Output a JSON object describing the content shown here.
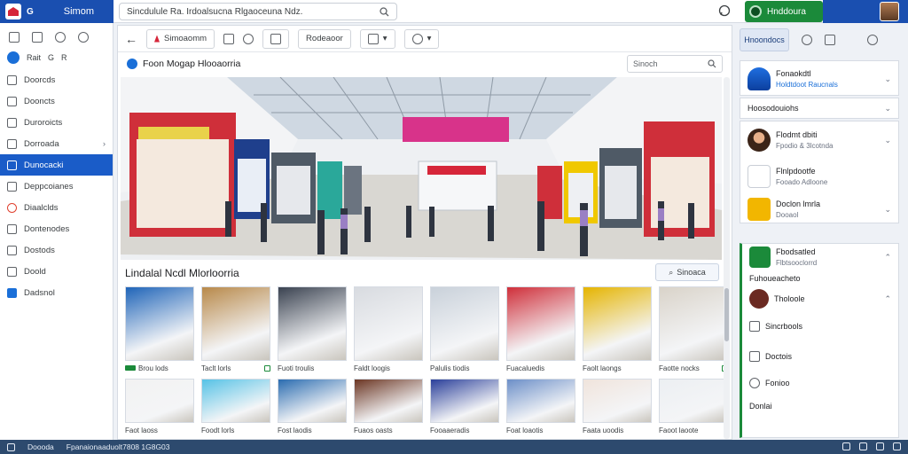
{
  "brand": {
    "logo": "store-logo",
    "short": "G",
    "name": "Simom"
  },
  "address_bar": {
    "value": "Sincdulule Ra. Irdoalsucna Rlgaoceuna Ndz."
  },
  "profile": {
    "label": "Hnddoura"
  },
  "sidebar": {
    "row2": [
      "Rait",
      "G",
      "R"
    ],
    "items": [
      {
        "label": "Doorcds",
        "icon": "doors-icon"
      },
      {
        "label": "Dooncts",
        "icon": "document-icon"
      },
      {
        "label": "Duroroicts",
        "icon": "list-icon"
      },
      {
        "label": "Dorroada",
        "icon": "folder-icon",
        "has_chevron": true
      },
      {
        "label": "Dunocacki",
        "icon": "store-icon",
        "active": true
      },
      {
        "label": "Deppcoianes",
        "icon": "device-icon"
      },
      {
        "label": "Diaalclds",
        "icon": "record-icon"
      },
      {
        "label": "Dontenodes",
        "icon": "file-icon"
      },
      {
        "label": "Dostods",
        "icon": "bag-icon"
      },
      {
        "label": "Doold",
        "icon": "note-icon"
      },
      {
        "label": "Dadsnol",
        "icon": "grid-icon"
      }
    ]
  },
  "toolbar": {
    "tab1": "Simoaomm",
    "tab2": "Rodeaoor"
  },
  "page": {
    "title": "Foon Mogap Hlooaorria",
    "search_placeholder": "Sinoch"
  },
  "gallery": {
    "title": "Lindalal Ncdl Mlorloorria",
    "search_label": "Sinoaca",
    "row1": [
      {
        "caption": "Brou lods",
        "badge": true
      },
      {
        "caption": "Taclt lorls",
        "check": true
      },
      {
        "caption": "Fuoti troulis"
      },
      {
        "caption": "Faldt loogis"
      },
      {
        "caption": "Palulis tiodis"
      },
      {
        "caption": "Fuacaluedis"
      },
      {
        "caption": "Faolt laongs"
      },
      {
        "caption": "Faotte nocks",
        "check": true
      }
    ],
    "row2": [
      {
        "caption": "Faot laoss"
      },
      {
        "caption": "Foodt lorls"
      },
      {
        "caption": "Fost laodis"
      },
      {
        "caption": "Fuaos oasts"
      },
      {
        "caption": "Fooaaeradis"
      },
      {
        "caption": "Foat loaotis"
      },
      {
        "caption": "Faata uoodis"
      },
      {
        "caption": "Faoot laoote"
      }
    ]
  },
  "right_panel": {
    "tab_active": "Hnoondocs",
    "items": [
      {
        "title": "Fonaokdtl",
        "sub": "Holdtdoot Raucnals"
      },
      {
        "title": "Hoosodouiohs"
      },
      {
        "title": "Flodmt dbiti",
        "sub": "Fpodio & 3lcotnda"
      },
      {
        "title": "Flnlpdootfe",
        "sub": "Fooado Adloone"
      },
      {
        "title": "Doclon lmrla",
        "sub": "Dooaol"
      },
      {
        "title": "Fbodsatled",
        "sub": "Flbtsooclorrd"
      },
      {
        "title": "Fuhoueacheto"
      },
      {
        "title": "Tholoole"
      },
      {
        "title": "Sincrbools"
      },
      {
        "title": "Doctois"
      },
      {
        "title": "Fonioo"
      },
      {
        "title": "Donlai"
      }
    ]
  },
  "status": {
    "left": "Doooda",
    "text": "Fpanaionaaduolt7808 1G8G03"
  },
  "colors": {
    "brand_blue": "#1a4fb0",
    "active_nav": "#1a5cc8",
    "green": "#1b8a3a",
    "status_bar": "#2d4a6e"
  }
}
